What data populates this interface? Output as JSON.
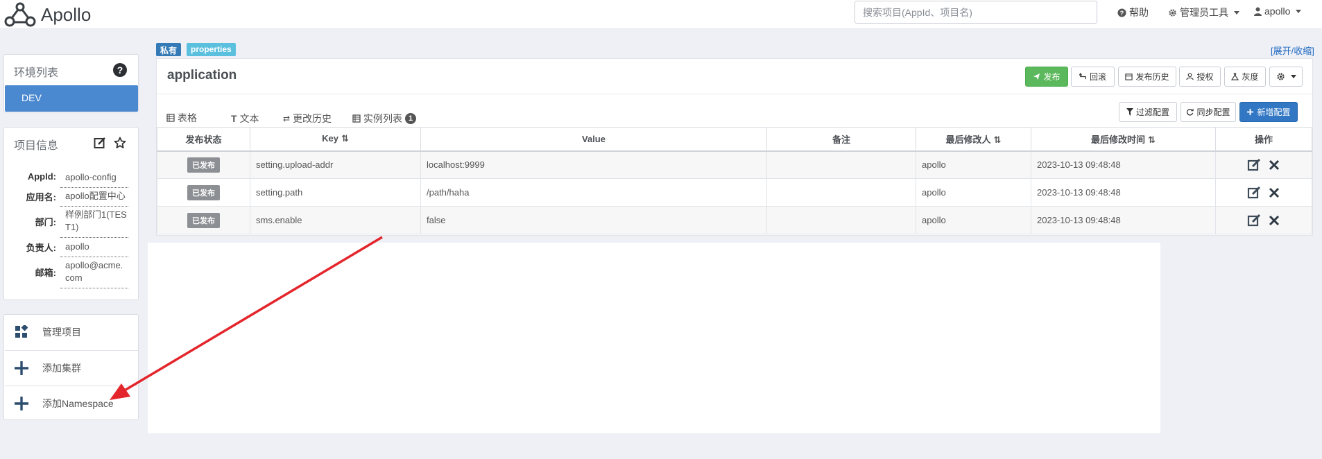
{
  "header": {
    "app_name": "Apollo",
    "search_placeholder": "搜索项目(AppId、项目名)",
    "help_label": "帮助",
    "admin_tools_label": "管理员工具",
    "user_label": "apollo"
  },
  "sidebar": {
    "env_title": "环境列表",
    "envs": [
      "DEV"
    ],
    "project_info_title": "项目信息",
    "project_info": [
      {
        "label": "AppId:",
        "value": "apollo-config"
      },
      {
        "label": "应用名:",
        "value": "apollo配置中心"
      },
      {
        "label": "部门:",
        "value": "样例部门1(TEST1)"
      },
      {
        "label": "负责人:",
        "value": "apollo"
      },
      {
        "label": "邮箱:",
        "value": "apollo@acme.com"
      }
    ],
    "actions": [
      {
        "label": "管理项目",
        "icon": "dashboard-icon"
      },
      {
        "label": "添加集群",
        "icon": "plus-icon"
      },
      {
        "label": "添加Namespace",
        "icon": "plus-icon"
      }
    ]
  },
  "namespace": {
    "tags": [
      "私有",
      "properties"
    ],
    "expand_label": "[展开/收缩]",
    "name": "application",
    "toolbar": {
      "publish": "发布",
      "rollback": "回滚",
      "history": "发布历史",
      "authorize": "授权",
      "gray": "灰度"
    },
    "tabs": [
      {
        "label": "表格",
        "icon": "table-icon"
      },
      {
        "label": "文本",
        "icon": "text-icon"
      },
      {
        "label": "更改历史",
        "icon": "history-icon"
      },
      {
        "label": "实例列表",
        "icon": "list-icon",
        "badge": "1"
      }
    ],
    "actions": {
      "filter": "过滤配置",
      "sync": "同步配置",
      "add": "新增配置"
    },
    "table": {
      "headers": [
        "发布状态",
        "Key",
        "Value",
        "备注",
        "最后修改人",
        "最后修改时间",
        "操作"
      ],
      "rows": [
        {
          "status": "已发布",
          "key": "setting.upload-addr",
          "value": "localhost:9999",
          "comment": "",
          "modifier": "apollo",
          "time": "2023-10-13 09:48:48"
        },
        {
          "status": "已发布",
          "key": "setting.path",
          "value": "/path/haha",
          "comment": "",
          "modifier": "apollo",
          "time": "2023-10-13 09:48:48"
        },
        {
          "status": "已发布",
          "key": "sms.enable",
          "value": "false",
          "comment": "",
          "modifier": "apollo",
          "time": "2023-10-13 09:48:48"
        }
      ]
    }
  },
  "colors": {
    "primary": "#3277c4",
    "env_active": "#4a88d0",
    "publish": "#5cb85c",
    "tag_private": "#337ab7",
    "tag_properties": "#5bc0de",
    "annotation_arrow": "#e3262c"
  }
}
